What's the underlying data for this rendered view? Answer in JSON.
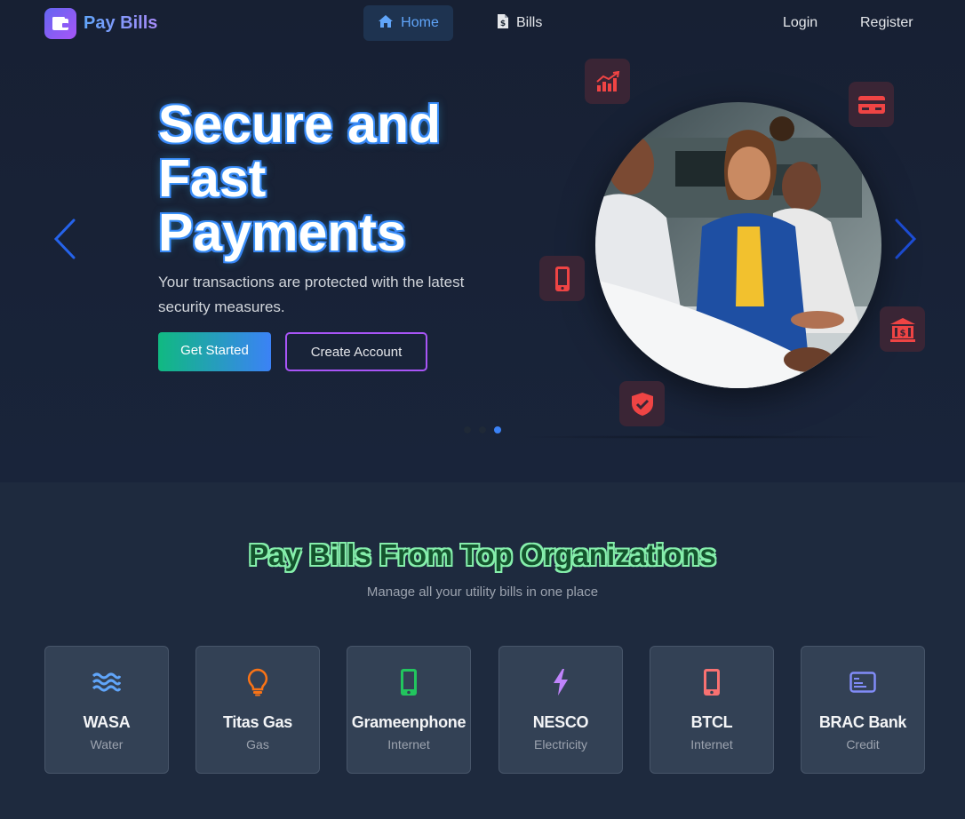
{
  "nav": {
    "brand": "Pay Bills",
    "links": [
      {
        "label": "Home",
        "icon": "home-icon"
      },
      {
        "label": "Bills",
        "icon": "file-invoice-dollar-icon"
      }
    ],
    "login": "Login",
    "register": "Register"
  },
  "hero": {
    "title": "Secure and Fast Payments",
    "subtitle": "Your transactions are protected with the latest security measures.",
    "primary_button": "Get Started",
    "secondary_button": "Create Account",
    "slide_count": 3,
    "active_slide": 3,
    "floating_icons": [
      "chart-up-icon",
      "credit-card-icon",
      "mobile-phone-icon",
      "bank-icon",
      "shield-check-icon"
    ]
  },
  "organizations": {
    "title": "Pay Bills From Top Organizations",
    "subtitle": "Manage all your utility bills in one place",
    "cards": [
      {
        "name": "WASA",
        "category": "Water",
        "icon": "water-icon",
        "color": "#60a5fa"
      },
      {
        "name": "Titas Gas",
        "category": "Gas",
        "icon": "lightbulb-icon",
        "color": "#f97316"
      },
      {
        "name": "Grameenphone",
        "category": "Internet",
        "icon": "mobile-phone-icon",
        "color": "#22c55e"
      },
      {
        "name": "NESCO",
        "category": "Electricity",
        "icon": "bolt-icon",
        "color": "#c084fc"
      },
      {
        "name": "BTCL",
        "category": "Internet",
        "icon": "mobile-phone-icon",
        "color": "#f87171"
      },
      {
        "name": "BRAC Bank",
        "category": "Credit",
        "icon": "credit-card-icon",
        "color": "#818cf8"
      }
    ]
  },
  "colors": {
    "accent_blue": "#3b82f6",
    "accent_purple": "#a855f7",
    "accent_green": "#10b981",
    "icon_red": "#ef4444"
  }
}
